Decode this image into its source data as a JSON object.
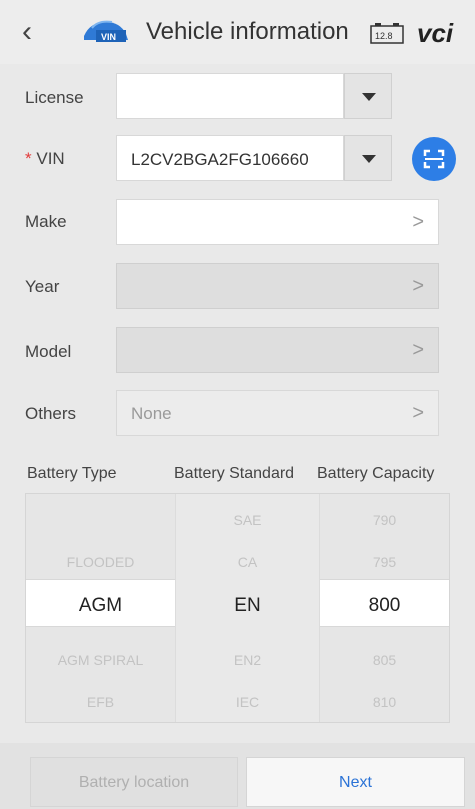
{
  "header": {
    "title": "Vehicle information",
    "logo_text": "VIN",
    "battery_voltage": "12.8",
    "vci_text": "vci"
  },
  "form": {
    "license": {
      "label": "License",
      "value": ""
    },
    "vin": {
      "required_mark": "*",
      "label": "VIN",
      "value": "L2CV2BGA2FG106660"
    },
    "make": {
      "label": "Make",
      "value": ""
    },
    "year": {
      "label": "Year",
      "value": ""
    },
    "model": {
      "label": "Model",
      "value": ""
    },
    "others": {
      "label": "Others",
      "placeholder": "None"
    },
    "chevron": ">"
  },
  "picker": {
    "headers": [
      "Battery Type",
      "Battery Standard",
      "Battery Capacity"
    ],
    "battery_type": [
      "",
      "FLOODED",
      "AGM",
      "AGM SPIRAL",
      "EFB"
    ],
    "battery_standard": [
      "SAE",
      "CA",
      "EN",
      "EN2",
      "IEC"
    ],
    "battery_capacity": [
      "790",
      "795",
      "800",
      "805",
      "810"
    ],
    "selected": {
      "battery_type": "AGM",
      "battery_standard": "EN",
      "battery_capacity": "800"
    }
  },
  "footer": {
    "battery_location": "Battery location",
    "next": "Next"
  },
  "colors": {
    "accent": "#2d7ee6",
    "required": "#e23b3b",
    "vci_green": "#3fb33f"
  }
}
